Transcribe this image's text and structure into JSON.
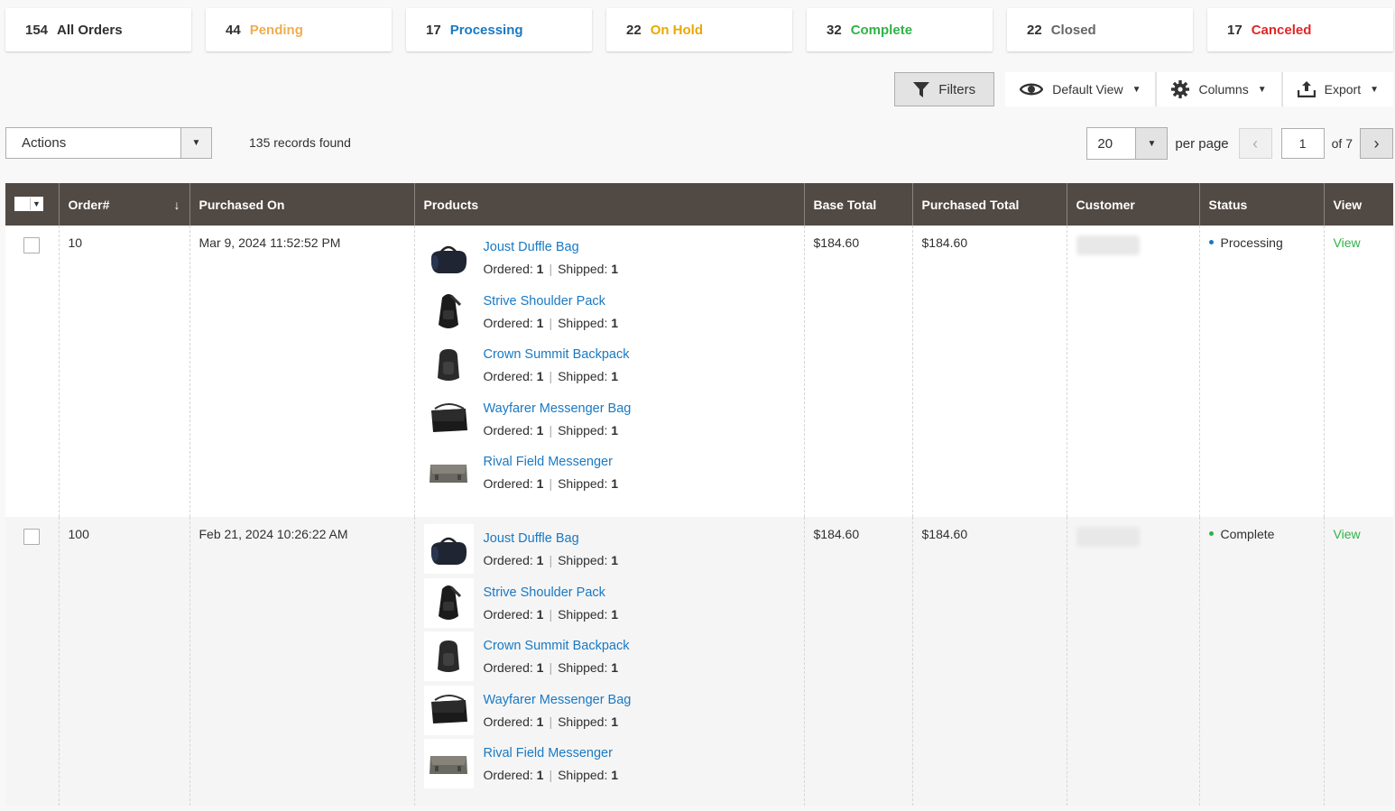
{
  "status_tabs": [
    {
      "count": "154",
      "label": "All Orders",
      "color": "#303030"
    },
    {
      "count": "44",
      "label": "Pending",
      "color": "#f0ad4e"
    },
    {
      "count": "17",
      "label": "Processing",
      "color": "#1979c3"
    },
    {
      "count": "22",
      "label": "On Hold",
      "color": "#eaa800"
    },
    {
      "count": "32",
      "label": "Complete",
      "color": "#2eb346"
    },
    {
      "count": "22",
      "label": "Closed",
      "color": "#666666"
    },
    {
      "count": "17",
      "label": "Canceled",
      "color": "#e22626"
    }
  ],
  "toolbar": {
    "filters_label": "Filters",
    "view_label": "Default View",
    "columns_label": "Columns",
    "export_label": "Export"
  },
  "actions": {
    "label": "Actions"
  },
  "records_found": "135 records found",
  "pager": {
    "per_page": "20",
    "per_page_label": "per page",
    "current_page": "1",
    "of_label": "of 7"
  },
  "columns": [
    "Order#",
    "Purchased On",
    "Products",
    "Base Total",
    "Purchased Total",
    "Customer",
    "Status",
    "View"
  ],
  "orders": [
    {
      "order": "10",
      "purchased_on": "Mar 9, 2024 11:52:52 PM",
      "base_total": "$184.60",
      "purchased_total": "$184.60",
      "status": "Processing",
      "status_color": "#1979c3",
      "view": "View",
      "products": [
        {
          "name": "Joust Duffle Bag",
          "icon": "duffle-bag-icon",
          "ordered_label": "Ordered:",
          "ordered": "1",
          "shipped_label": "Shipped:",
          "shipped": "1"
        },
        {
          "name": "Strive Shoulder Pack",
          "icon": "shoulder-pack-icon",
          "ordered_label": "Ordered:",
          "ordered": "1",
          "shipped_label": "Shipped:",
          "shipped": "1"
        },
        {
          "name": "Crown Summit Backpack",
          "icon": "backpack-icon",
          "ordered_label": "Ordered:",
          "ordered": "1",
          "shipped_label": "Shipped:",
          "shipped": "1"
        },
        {
          "name": "Wayfarer Messenger Bag",
          "icon": "messenger-bag-icon",
          "ordered_label": "Ordered:",
          "ordered": "1",
          "shipped_label": "Shipped:",
          "shipped": "1"
        },
        {
          "name": "Rival Field Messenger",
          "icon": "field-messenger-icon",
          "ordered_label": "Ordered:",
          "ordered": "1",
          "shipped_label": "Shipped:",
          "shipped": "1"
        }
      ]
    },
    {
      "order": "100",
      "purchased_on": "Feb 21, 2024 10:26:22 AM",
      "base_total": "$184.60",
      "purchased_total": "$184.60",
      "status": "Complete",
      "status_color": "#2eb346",
      "view": "View",
      "products": [
        {
          "name": "Joust Duffle Bag",
          "icon": "duffle-bag-icon",
          "ordered_label": "Ordered:",
          "ordered": "1",
          "shipped_label": "Shipped:",
          "shipped": "1"
        },
        {
          "name": "Strive Shoulder Pack",
          "icon": "shoulder-pack-icon",
          "ordered_label": "Ordered:",
          "ordered": "1",
          "shipped_label": "Shipped:",
          "shipped": "1"
        },
        {
          "name": "Crown Summit Backpack",
          "icon": "backpack-icon",
          "ordered_label": "Ordered:",
          "ordered": "1",
          "shipped_label": "Shipped:",
          "shipped": "1"
        },
        {
          "name": "Wayfarer Messenger Bag",
          "icon": "messenger-bag-icon",
          "ordered_label": "Ordered:",
          "ordered": "1",
          "shipped_label": "Shipped:",
          "shipped": "1"
        },
        {
          "name": "Rival Field Messenger",
          "icon": "field-messenger-icon",
          "ordered_label": "Ordered:",
          "ordered": "1",
          "shipped_label": "Shipped:",
          "shipped": "1"
        }
      ]
    }
  ]
}
